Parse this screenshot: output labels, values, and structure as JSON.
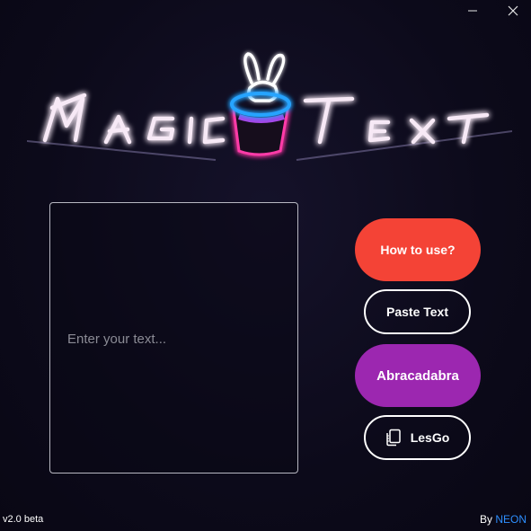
{
  "window": {
    "minimize_icon": "minimize-icon",
    "close_icon": "close-icon"
  },
  "logo": {
    "text": "MAGIC TEXT",
    "icon": "bunny-in-hat-icon",
    "colors": {
      "text_glow": "#ff7be6",
      "hat_brim": "#27a4ff",
      "hat_body": "#ff3aa8",
      "bunny": "#ffffff"
    }
  },
  "editor": {
    "placeholder": "Enter your text...",
    "value": ""
  },
  "buttons": {
    "how_to_use": "How to use?",
    "paste_text": "Paste Text",
    "abracadabra": "Abracadabra",
    "lesgo": "LesGo",
    "lesgo_icon": "copy-icon"
  },
  "footer": {
    "version": "v2.0 beta",
    "by": "By ",
    "author": "NEON"
  },
  "colors": {
    "background": "#0d0a1c",
    "how_to_use_bg": "#f44336",
    "abracadabra_bg": "#9c27b0",
    "author_color": "#2e8fff"
  }
}
